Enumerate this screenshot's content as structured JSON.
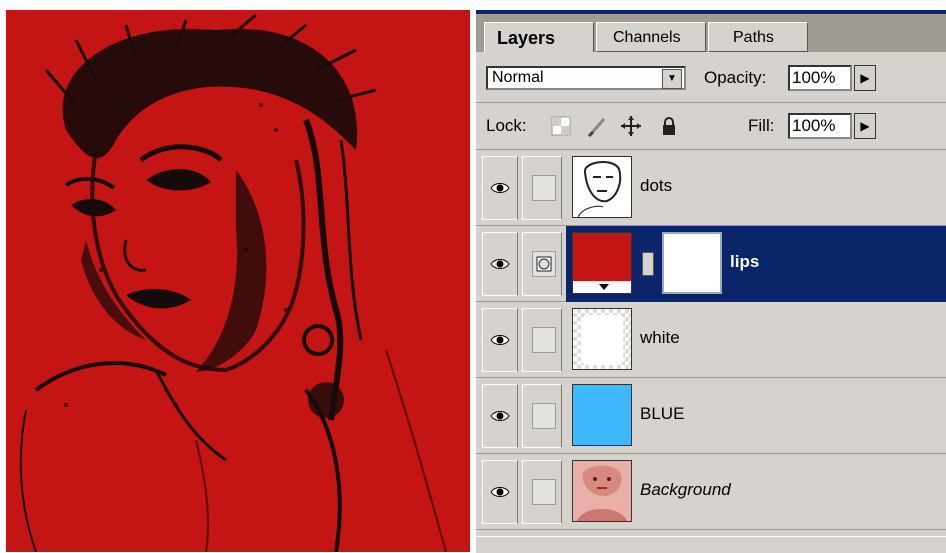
{
  "panel": {
    "tabs": [
      {
        "label": "Layers",
        "active": true
      },
      {
        "label": "Channels",
        "active": false
      },
      {
        "label": "Paths",
        "active": false
      }
    ],
    "blend_mode": "Normal",
    "opacity_label": "Opacity:",
    "opacity_value": "100%",
    "lock_label": "Lock:",
    "fill_label": "Fill:",
    "fill_value": "100%",
    "layers": [
      {
        "name": "dots",
        "selected": false,
        "thumb": "portrait-sketch"
      },
      {
        "name": "lips",
        "selected": true,
        "thumb": "red-fill",
        "mask": "white"
      },
      {
        "name": "white",
        "selected": false,
        "thumb": "white-fill"
      },
      {
        "name": "BLUE",
        "selected": false,
        "thumb": "blue-fill"
      },
      {
        "name": "Background",
        "selected": false,
        "thumb": "portrait-photo"
      }
    ]
  },
  "colors": {
    "canvas_red": "#c41414",
    "selection_blue": "#0a246a",
    "blue_layer": "#3fb8ff",
    "panel_gray": "#d6d3ce"
  },
  "icons": [
    "eye-icon",
    "lock-transparency-icon",
    "lock-brush-icon",
    "lock-move-icon",
    "lock-all-icon",
    "chain-link-icon",
    "dropdown-arrow-icon",
    "step-arrow-icon"
  ]
}
